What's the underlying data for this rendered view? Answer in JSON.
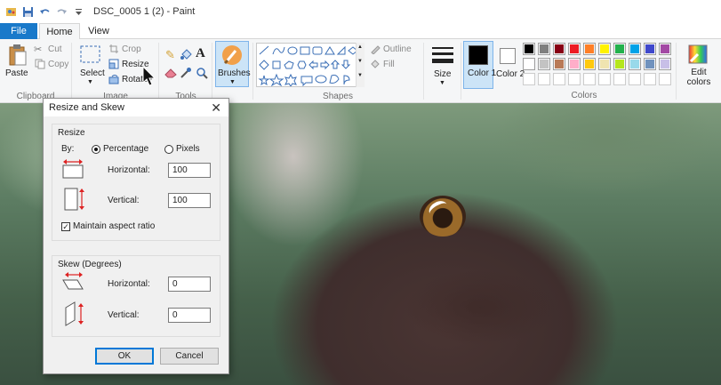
{
  "window": {
    "title": "DSC_0005 1 (2) - Paint"
  },
  "tabs": [
    "File",
    "Home",
    "View"
  ],
  "ribbon": {
    "clipboard": {
      "paste": "Paste",
      "cut": "Cut",
      "copy": "Copy",
      "group": "Clipboard"
    },
    "image": {
      "select": "Select",
      "crop": "Crop",
      "resize": "Resize",
      "rotate": "Rotate",
      "group": "Image"
    },
    "tools": {
      "group": "Tools"
    },
    "brushes": "Brushes",
    "shapes": {
      "outline": "Outline",
      "fill": "Fill",
      "group": "Shapes"
    },
    "size": "Size",
    "color1": "Color 1",
    "color2": "Color 2",
    "colors_group": "Colors",
    "edit_colors": "Edit colors",
    "palette_row1": [
      "#000000",
      "#7f7f7f",
      "#880015",
      "#ed1c24",
      "#ff7f27",
      "#fff200",
      "#22b14c",
      "#00a2e8",
      "#3f48cc",
      "#a349a4"
    ],
    "palette_row2": [
      "#ffffff",
      "#c3c3c3",
      "#b97a57",
      "#ffaec9",
      "#ffc90e",
      "#efe4b0",
      "#b5e61d",
      "#99d9ea",
      "#7092be",
      "#c8bfe7"
    ],
    "color1_value": "#000000",
    "color2_value": "#ffffff"
  },
  "dialog": {
    "title": "Resize and Skew",
    "resize_section": "Resize",
    "by_label": "By:",
    "percentage": "Percentage",
    "pixels": "Pixels",
    "horizontal": "Horizontal:",
    "vertical": "Vertical:",
    "resize_h": "100",
    "resize_v": "100",
    "maintain": "Maintain aspect ratio",
    "skew_section": "Skew (Degrees)",
    "skew_h_label": "Horizontal:",
    "skew_v_label": "Vertical:",
    "skew_h": "0",
    "skew_v": "0",
    "ok": "OK",
    "cancel": "Cancel"
  }
}
